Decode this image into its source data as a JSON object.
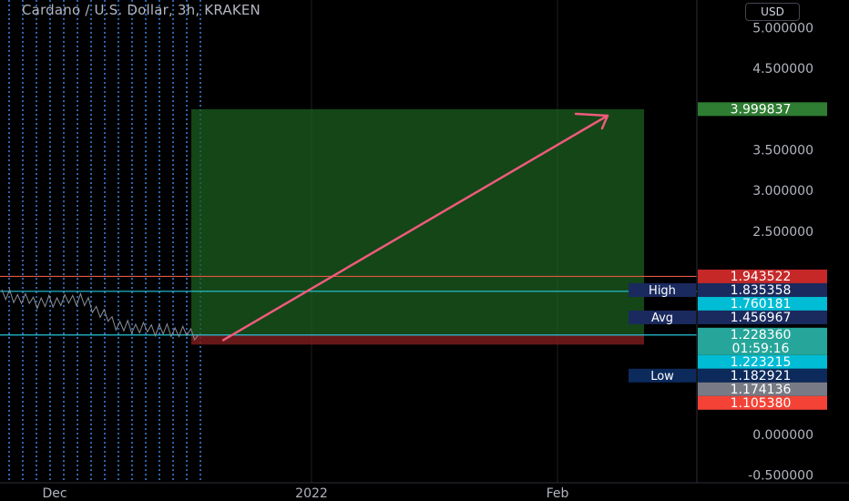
{
  "header": {
    "symbol_title": "Cardano / U.S. Dollar, 3h, KRAKEN",
    "currency_button": "USD"
  },
  "chart_data": {
    "type": "line",
    "title": "Cardano / U.S. Dollar, 3h, KRAKEN",
    "y_axis_side": "right",
    "ylim": [
      -0.6,
      5.3
    ],
    "y_ticks": [
      "5.000000",
      "4.500000",
      "3.500000",
      "3.000000",
      "2.500000",
      "0.000000",
      "-0.500000"
    ],
    "x_ticks": [
      "Dec",
      "2022",
      "Feb"
    ],
    "price_series": {
      "x": [
        "Dec",
        "Dec",
        "Dec",
        "Dec",
        "Dec",
        "Dec"
      ],
      "close": [
        1.72,
        1.62,
        1.67,
        1.33,
        1.29,
        1.24
      ],
      "last": 1.22836
    },
    "position_tool": {
      "entry": 1.22836,
      "target": 3.999837,
      "stop": 1.10538,
      "profit_color": "#1b5e20",
      "loss_color": "#7f1d1d"
    },
    "arrow_color": "#ef5b7b",
    "horizontal_lines": [
      {
        "value": 1.943522,
        "color": "#e0583f"
      },
      {
        "value": 1.760181,
        "color": "#26c6da"
      },
      {
        "value": 1.223215,
        "color": "#26c6da"
      }
    ],
    "price_labels": [
      {
        "value": 3.999837,
        "text": "3.999837",
        "bg": "#2e7d32"
      },
      {
        "value": 1.943522,
        "text": "1.943522",
        "bg": "#c62828"
      },
      {
        "value": 1.835358,
        "text": "1.835358",
        "bg": "#1a2a5e",
        "tag": "High"
      },
      {
        "value": 1.760181,
        "text": "1.760181",
        "bg": "#00bcd4"
      },
      {
        "value": 1.456967,
        "text": "1.456967",
        "bg": "#1a2a5e",
        "tag": "Avg"
      },
      {
        "value": 1.22836,
        "text": "1.228360",
        "bg": "#26a69a",
        "sub": "01:59:16"
      },
      {
        "value": 1.223215,
        "text": "1.223215",
        "bg": "#00bcd4"
      },
      {
        "value": 1.182921,
        "text": "1.182921",
        "bg": "#0d2a5c",
        "tag": "Low"
      },
      {
        "value": 1.174136,
        "text": "1.174136",
        "bg": "#787b86"
      },
      {
        "value": 1.10538,
        "text": "1.105380",
        "bg": "#f44336"
      }
    ],
    "legend": "none",
    "grid": true
  }
}
